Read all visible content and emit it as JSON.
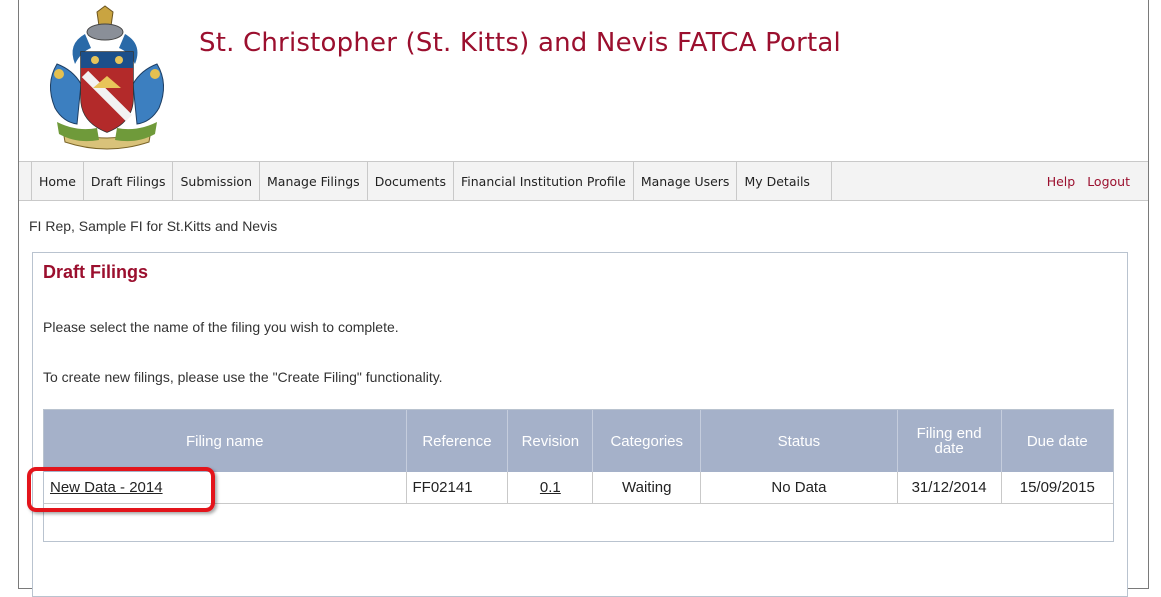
{
  "header": {
    "title": "St. Christopher (St. Kitts) and Nevis FATCA Portal",
    "crest_icon": "coat-of-arms-icon",
    "crest_motto": "COUNTRY ABOVE SELF"
  },
  "nav": {
    "items": [
      {
        "label": "Home"
      },
      {
        "label": "Draft Filings"
      },
      {
        "label": "Submission"
      },
      {
        "label": "Manage Filings"
      },
      {
        "label": "Documents"
      },
      {
        "label": "Financial Institution Profile"
      },
      {
        "label": "Manage Users"
      },
      {
        "label": "My Details"
      }
    ],
    "help_label": "Help",
    "logout_label": "Logout"
  },
  "user_line": "FI Rep, Sample FI for St.Kitts and Nevis",
  "panel": {
    "title": "Draft Filings",
    "instruction1": "Please select the name of the filing you wish to complete.",
    "instruction2": "To create new filings, please use the \"Create Filing\" functionality."
  },
  "table": {
    "headers": {
      "filing_name": "Filing name",
      "reference": "Reference",
      "revision": "Revision",
      "categories": "Categories",
      "status": "Status",
      "filing_end_date": "Filing end date",
      "due_date": "Due date"
    },
    "rows": [
      {
        "filing_name": "New Data - 2014",
        "reference": "FF02141",
        "revision": "0.1",
        "categories": "Waiting",
        "status": "No Data",
        "filing_end_date": "31/12/2014",
        "due_date": "15/09/2015"
      }
    ]
  },
  "colors": {
    "brand": "#9b0f2e",
    "table_header": "#a5b1c9",
    "highlight": "#e3141b"
  }
}
